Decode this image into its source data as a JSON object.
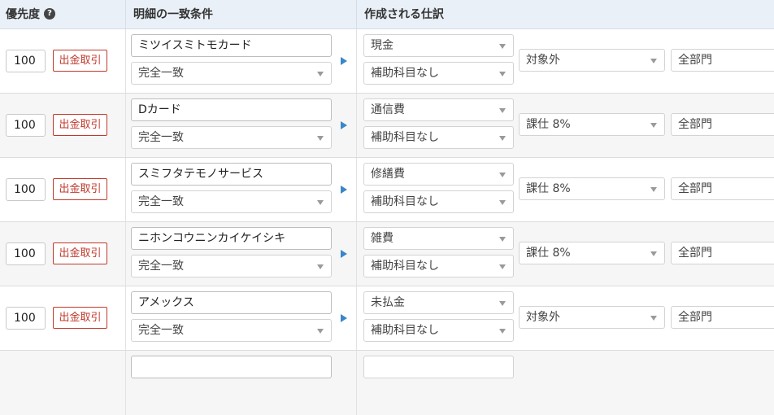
{
  "header": {
    "priority_label": "優先度",
    "help_icon": "question-circle-icon",
    "condition_label": "明細の一致条件",
    "entry_label": "作成される仕訳"
  },
  "rules": [
    {
      "priority": "100",
      "tag": "出金取引",
      "description": "ミツイスミトモカード",
      "match": "完全一致",
      "account": "現金",
      "sub_account": "補助科目なし",
      "tax": "対象外",
      "department": "全部門"
    },
    {
      "priority": "100",
      "tag": "出金取引",
      "description": "Dカード",
      "match": "完全一致",
      "account": "通信費",
      "sub_account": "補助科目なし",
      "tax": "課仕 8%",
      "department": "全部門"
    },
    {
      "priority": "100",
      "tag": "出金取引",
      "description": "スミフタテモノサービス",
      "match": "完全一致",
      "account": "修繕費",
      "sub_account": "補助科目なし",
      "tax": "課仕 8%",
      "department": "全部門"
    },
    {
      "priority": "100",
      "tag": "出金取引",
      "description": "ニホンコウニンカイケイシキ",
      "match": "完全一致",
      "account": "雑費",
      "sub_account": "補助科目なし",
      "tax": "課仕 8%",
      "department": "全部門"
    },
    {
      "priority": "100",
      "tag": "出金取引",
      "description": "アメックス",
      "match": "完全一致",
      "account": "未払金",
      "sub_account": "補助科目なし",
      "tax": "対象外",
      "department": "全部門"
    }
  ],
  "colors": {
    "header_bg": "#e9f0f7",
    "tag_red": "#c0392b",
    "arrow_blue": "#3a86c8"
  }
}
